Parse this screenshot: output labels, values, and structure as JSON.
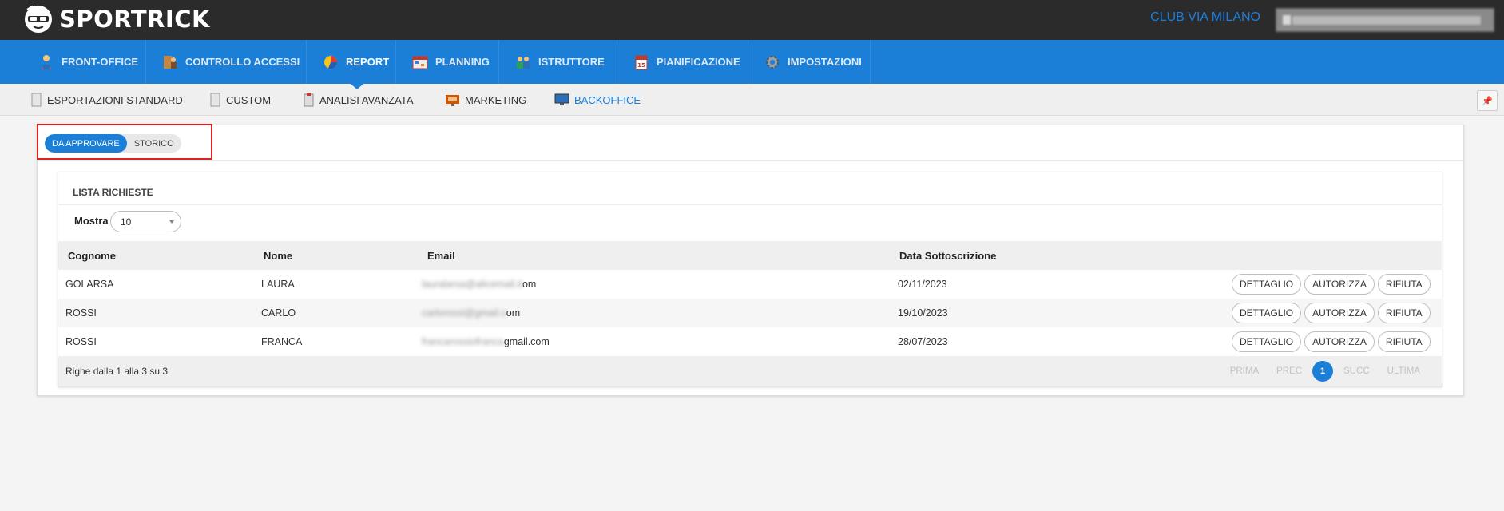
{
  "app": {
    "name": "SPORTRICK",
    "club": "CLUB VIA MILANO",
    "user": "[blurred account email]"
  },
  "main_nav": [
    {
      "label": "FRONT-OFFICE",
      "icon": "person-icon",
      "active": false
    },
    {
      "label": "CONTROLLO ACCESSI",
      "icon": "access-control-icon",
      "active": false
    },
    {
      "label": "REPORT",
      "icon": "pie-chart-icon",
      "active": true
    },
    {
      "label": "PLANNING",
      "icon": "calendar-grid-icon",
      "active": false
    },
    {
      "label": "ISTRUTTORE",
      "icon": "instructor-icon",
      "active": false
    },
    {
      "label": "PIANIFICAZIONE",
      "icon": "calendar-icon",
      "active": false
    },
    {
      "label": "IMPOSTAZIONI",
      "icon": "gear-icon",
      "active": false
    }
  ],
  "sub_nav": [
    {
      "label": "ESPORTAZIONI STANDARD",
      "icon": "document-icon",
      "active": false
    },
    {
      "label": "CUSTOM",
      "icon": "document-icon",
      "active": false
    },
    {
      "label": "ANALISI AVANZATA",
      "icon": "clipboard-icon",
      "active": false
    },
    {
      "label": "MARKETING",
      "icon": "marketing-icon",
      "active": false
    },
    {
      "label": "BACKOFFICE",
      "icon": "monitor-icon",
      "active": true
    }
  ],
  "tabs": {
    "active": "DA APPROVARE",
    "other": "STORICO"
  },
  "list": {
    "title": "LISTA RICHIESTE",
    "show_label": "Mostra",
    "show_value": "10",
    "columns": [
      "Cognome",
      "Nome",
      "Email",
      "Data Sottoscrizione"
    ],
    "rows": [
      {
        "cognome": "GOLARSA",
        "nome": "LAURA",
        "email_hidden": "lauralarsa@alicemail.it",
        "email_visible": "om",
        "data": "02/11/2023"
      },
      {
        "cognome": "ROSSI",
        "nome": "CARLO",
        "email_hidden": "carlorossi@gmail.c",
        "email_visible": "om",
        "data": "19/10/2023"
      },
      {
        "cognome": "ROSSI",
        "nome": "FRANCA",
        "email_hidden": "francarossiofranca",
        "email_visible": "gmail.com",
        "data": "28/07/2023"
      }
    ],
    "row_actions": [
      "DETTAGLIO",
      "AUTORIZZA",
      "RIFIUTA"
    ],
    "footer_info": "Righe dalla 1 alla 3 su 3",
    "pager": {
      "first": "PRIMA",
      "prev": "PREC",
      "current": "1",
      "next": "SUCC",
      "last": "ULTIMA"
    }
  },
  "pin_label": "📌",
  "colors": {
    "topbar": "#2b2b2b",
    "nav": "#1b7fd8",
    "accent": "#1b7fd8",
    "highlight": "#e02020"
  }
}
